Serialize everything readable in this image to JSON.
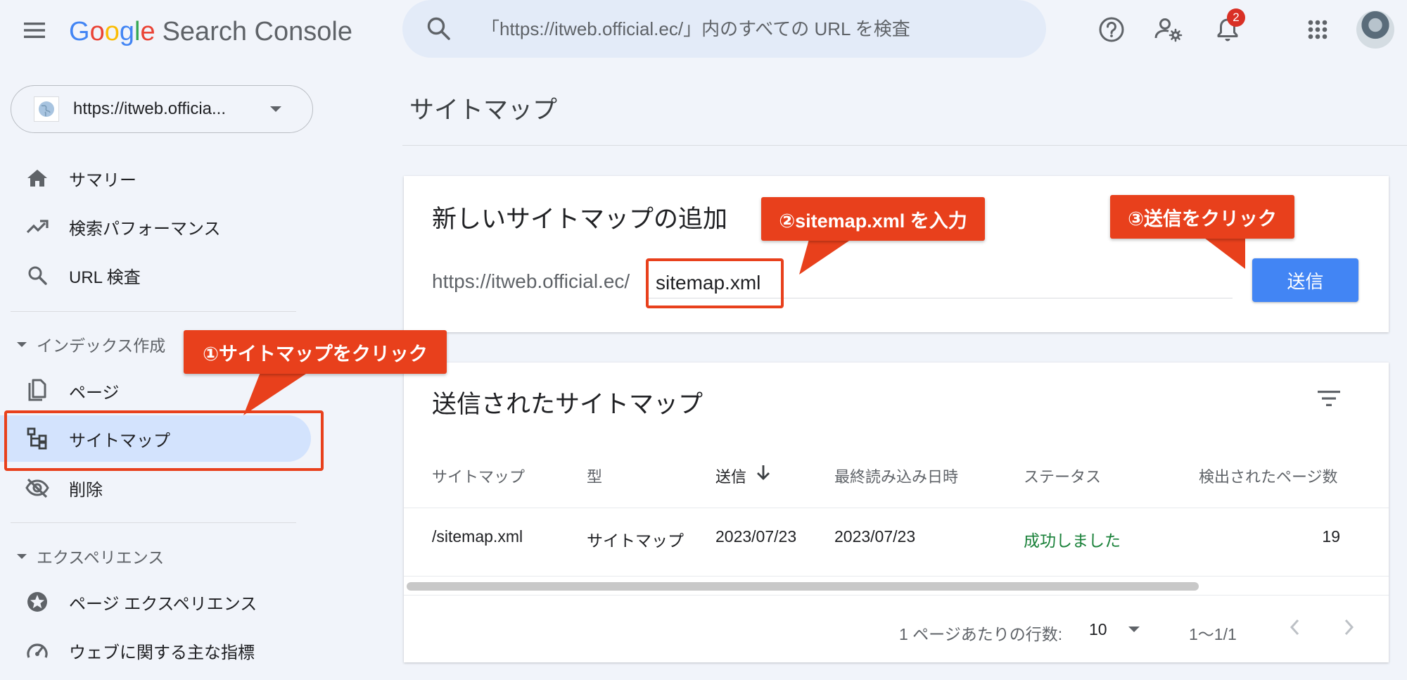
{
  "app": {
    "logo_google": [
      "G",
      "o",
      "o",
      "g",
      "l",
      "e"
    ],
    "logo_product": "Search Console",
    "search_placeholder": "「https://itweb.official.ec/」内のすべての URL を検査",
    "notification_count": "2"
  },
  "sidebar": {
    "property": "https://itweb.officia...",
    "items_top": [
      {
        "label": "サマリー",
        "icon": "home-icon"
      },
      {
        "label": "検索パフォーマンス",
        "icon": "trending-up-icon"
      },
      {
        "label": "URL 検査",
        "icon": "search-icon"
      }
    ],
    "section_index": "インデックス作成",
    "items_index": [
      {
        "label": "ページ",
        "icon": "pages-icon"
      },
      {
        "label": "サイトマップ",
        "icon": "sitemap-icon",
        "active": true
      },
      {
        "label": "削除",
        "icon": "visibility-off-icon"
      }
    ],
    "section_experience": "エクスペリエンス",
    "items_experience": [
      {
        "label": "ページ エクスペリエンス",
        "icon": "page-experience-icon"
      },
      {
        "label": "ウェブに関する主な指標",
        "icon": "speed-gauge-icon"
      }
    ]
  },
  "main": {
    "page_title": "サイトマップ",
    "add_card": {
      "title": "新しいサイトマップの追加",
      "prefix": "https://itweb.official.ec/",
      "input_value": "sitemap.xml",
      "submit_label": "送信"
    },
    "list_card": {
      "title": "送信されたサイトマップ",
      "columns": [
        "サイトマップ",
        "型",
        "送信",
        "最終読み込み日時",
        "ステータス",
        "検出されたページ数"
      ],
      "rows": [
        {
          "sitemap": "/sitemap.xml",
          "type": "サイトマップ",
          "submitted": "2023/07/23",
          "last_read": "2023/07/23",
          "status": "成功しました",
          "pages": "19"
        }
      ],
      "rows_per_page_label": "1 ページあたりの行数:",
      "rows_per_page_value": "10",
      "range": "1〜1/1"
    }
  },
  "annotations": {
    "step1": "①サイトマップをクリック",
    "step2": "②sitemap.xml を入力",
    "step3": "③送信をクリック"
  },
  "colors": {
    "accent": "#4285f4",
    "annotation": "#e8401c",
    "success": "#188038",
    "active_nav": "#d3e3fd"
  }
}
